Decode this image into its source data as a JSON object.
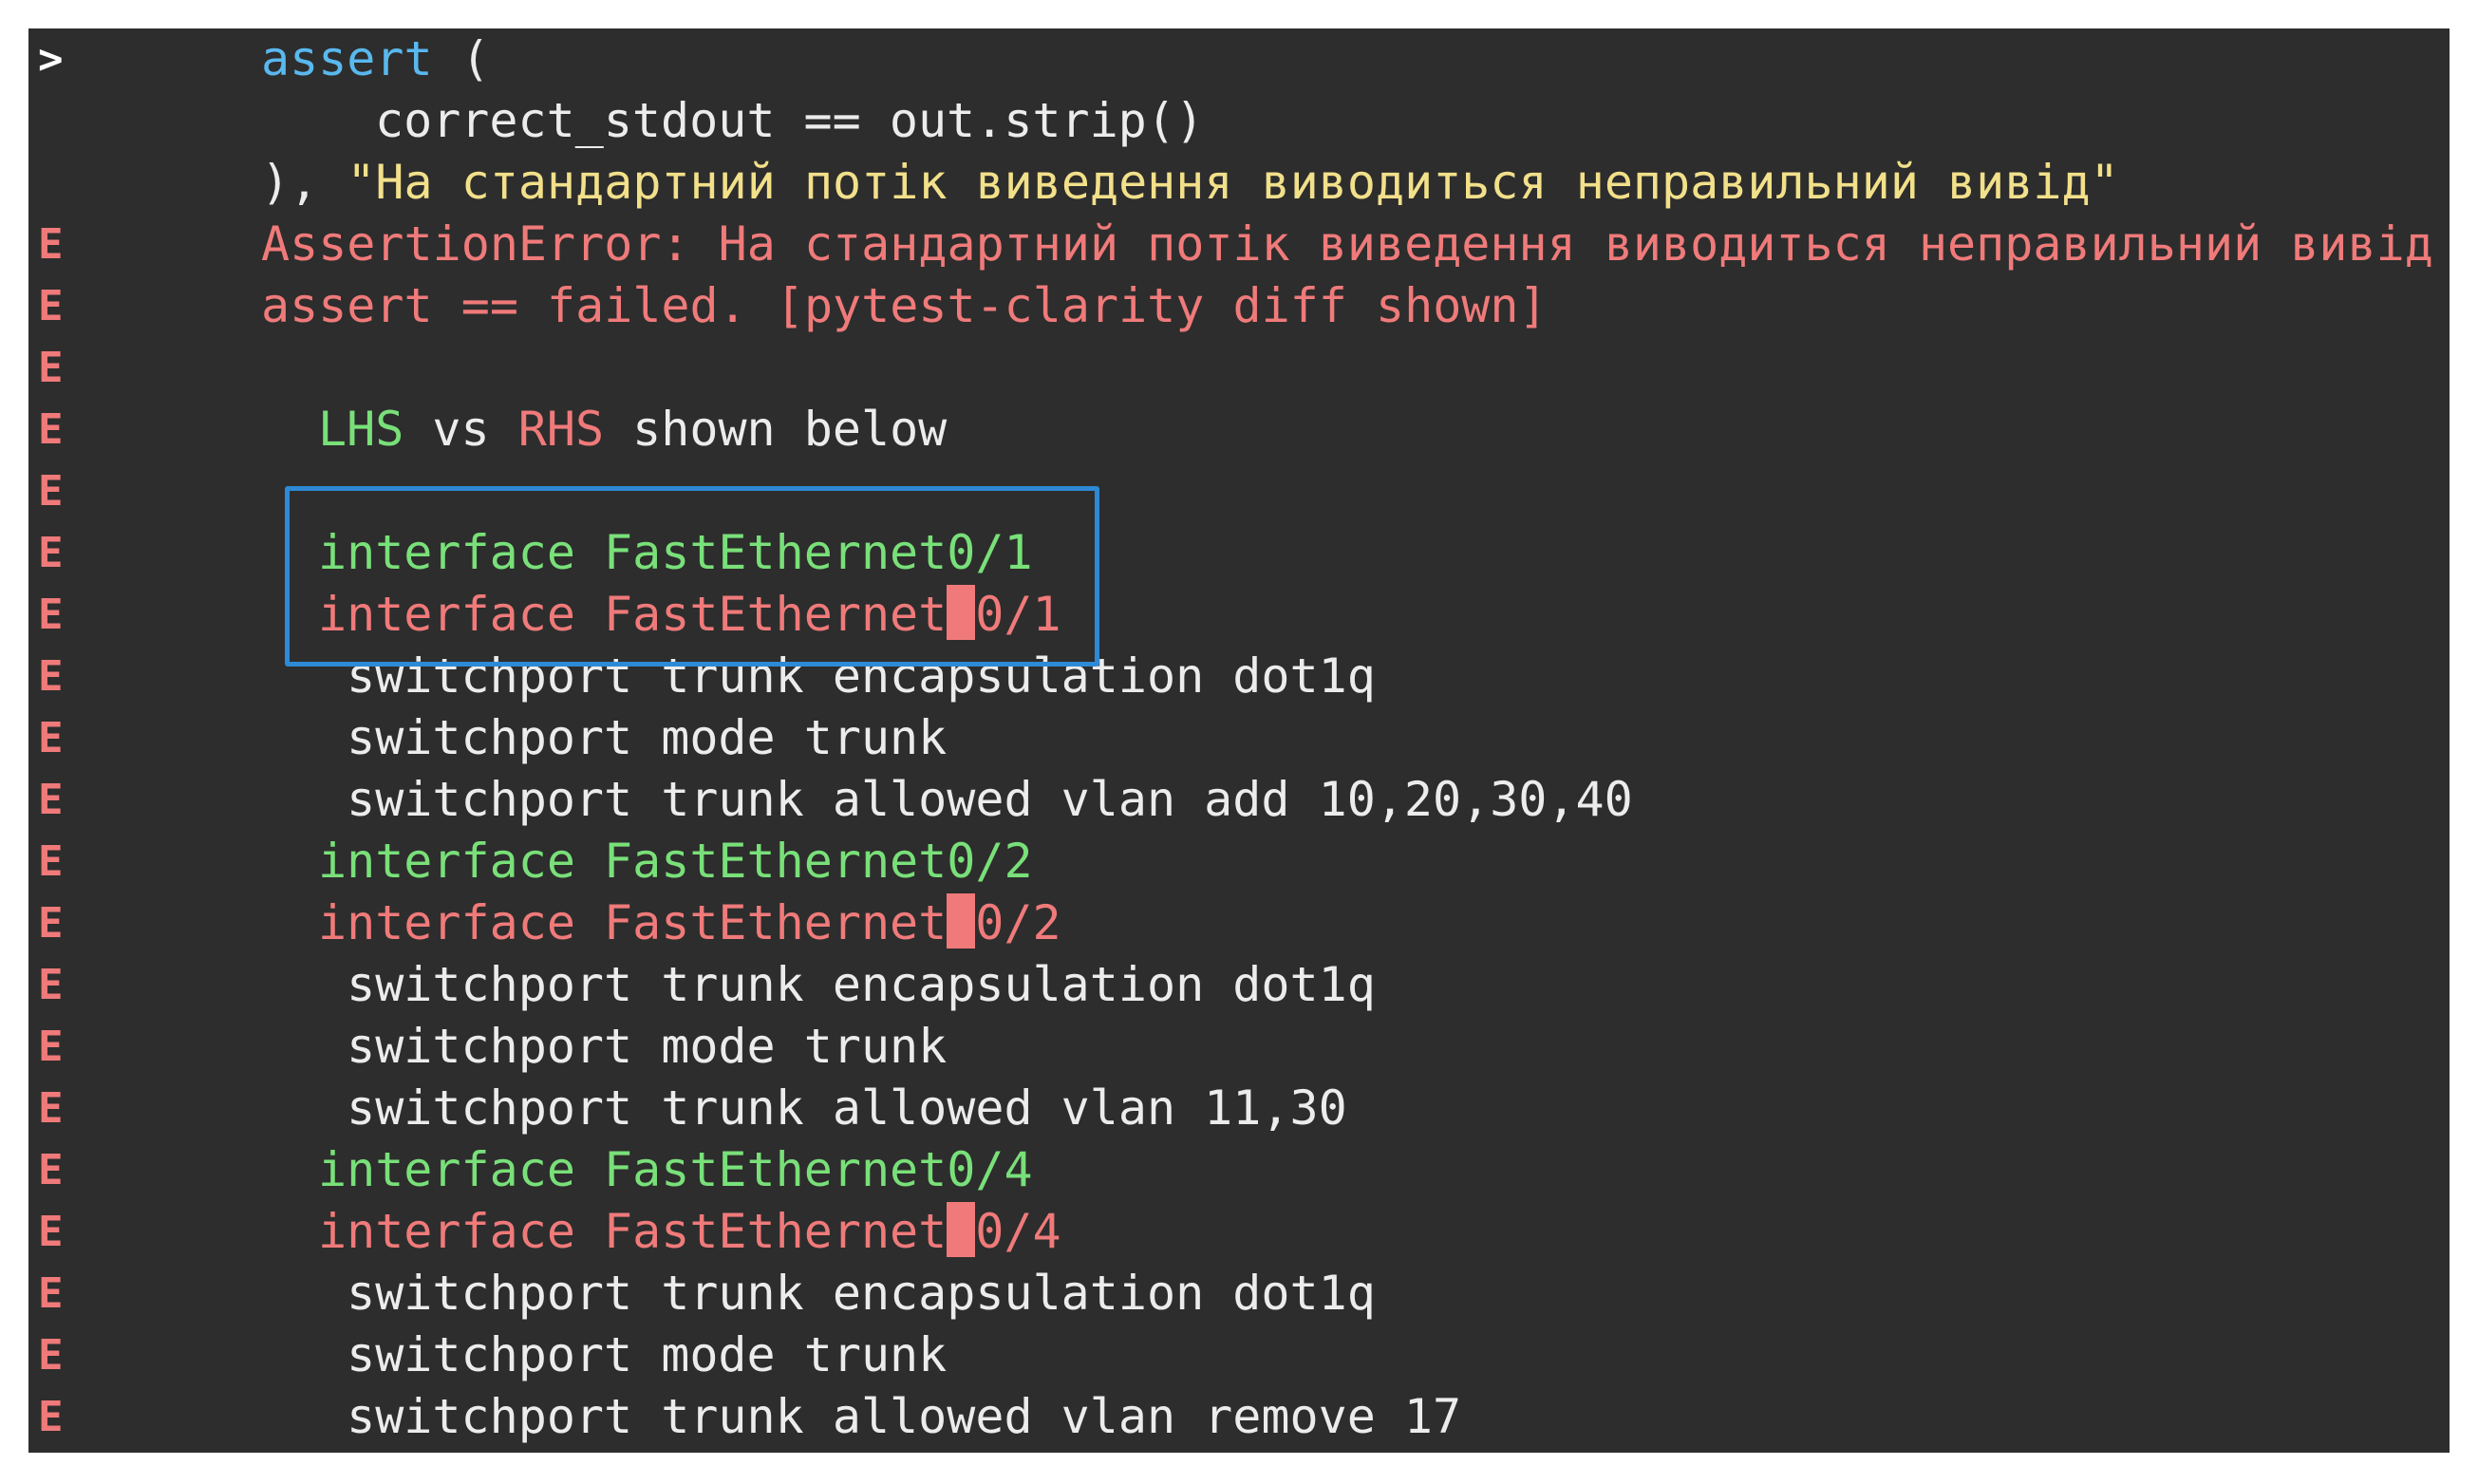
{
  "terminal": {
    "lines": [
      {
        "marker": ">",
        "segments": [
          {
            "text": "assert",
            "color": "blue"
          },
          {
            "text": " (",
            "color": "white"
          }
        ]
      },
      {
        "marker": "",
        "segments": [
          {
            "text": "correct_stdout == out.strip()",
            "color": "white"
          }
        ]
      },
      {
        "marker": "",
        "segments": [
          {
            "text": "), ",
            "color": "white"
          },
          {
            "text": "\"На стандартний потік виведення виводиться неправильний вивід\"",
            "color": "yellow"
          }
        ]
      },
      {
        "marker": "E",
        "segments": [
          {
            "text": "AssertionError: На стандартний потік виведення виводиться неправильний вивід",
            "color": "red"
          }
        ]
      },
      {
        "marker": "E",
        "segments": [
          {
            "text": "assert == failed. [pytest-clarity diff shown]",
            "color": "red"
          }
        ]
      },
      {
        "marker": "E",
        "segments": []
      },
      {
        "marker": "E",
        "segments": [
          {
            "text": "LHS",
            "color": "green"
          },
          {
            "text": " vs ",
            "color": "white"
          },
          {
            "text": "RHS",
            "color": "red"
          },
          {
            "text": " shown below",
            "color": "white"
          }
        ]
      },
      {
        "marker": "E",
        "segments": []
      },
      {
        "marker": "E",
        "segments": [
          {
            "text": "interface FastEthernet0/1",
            "color": "green"
          }
        ]
      },
      {
        "marker": "E",
        "segments": [
          {
            "text": "interface FastEthernet",
            "color": "red"
          },
          {
            "text": "0/1",
            "color": "red"
          }
        ]
      },
      {
        "marker": "E",
        "segments": [
          {
            "text": " switchport trunk encapsulation dot1q",
            "color": "white"
          }
        ]
      },
      {
        "marker": "E",
        "segments": [
          {
            "text": " switchport mode trunk",
            "color": "white"
          }
        ]
      },
      {
        "marker": "E",
        "segments": [
          {
            "text": " switchport trunk allowed vlan add 10,20,30,40",
            "color": "white"
          }
        ]
      },
      {
        "marker": "E",
        "segments": [
          {
            "text": "interface FastEthernet0/2",
            "color": "green"
          }
        ]
      },
      {
        "marker": "E",
        "segments": [
          {
            "text": "interface FastEthernet",
            "color": "red"
          },
          {
            "text": "0/2",
            "color": "red"
          }
        ]
      },
      {
        "marker": "E",
        "segments": [
          {
            "text": " switchport trunk encapsulation dot1q",
            "color": "white"
          }
        ]
      },
      {
        "marker": "E",
        "segments": [
          {
            "text": " switchport mode trunk",
            "color": "white"
          }
        ]
      },
      {
        "marker": "E",
        "segments": [
          {
            "text": " switchport trunk allowed vlan 11,30",
            "color": "white"
          }
        ]
      },
      {
        "marker": "E",
        "segments": [
          {
            "text": "interface FastEthernet0/4",
            "color": "green"
          }
        ]
      },
      {
        "marker": "E",
        "segments": [
          {
            "text": "interface FastEthernet",
            "color": "red"
          },
          {
            "text": "0/4",
            "color": "red"
          }
        ]
      },
      {
        "marker": "E",
        "segments": [
          {
            "text": " switchport trunk encapsulation dot1q",
            "color": "white"
          }
        ]
      },
      {
        "marker": "E",
        "segments": [
          {
            "text": " switchport mode trunk",
            "color": "white"
          }
        ]
      },
      {
        "marker": "E",
        "segments": [
          {
            "text": " switchport trunk allowed vlan remove 17",
            "color": "white"
          }
        ]
      }
    ]
  },
  "colors": {
    "background": "#2d2d2d",
    "white": "#ececec",
    "blue": "#59b8ee",
    "yellow": "#f2e08a",
    "red": "#f07a7a",
    "green": "#79e079",
    "annotation": "#2e89d6"
  }
}
